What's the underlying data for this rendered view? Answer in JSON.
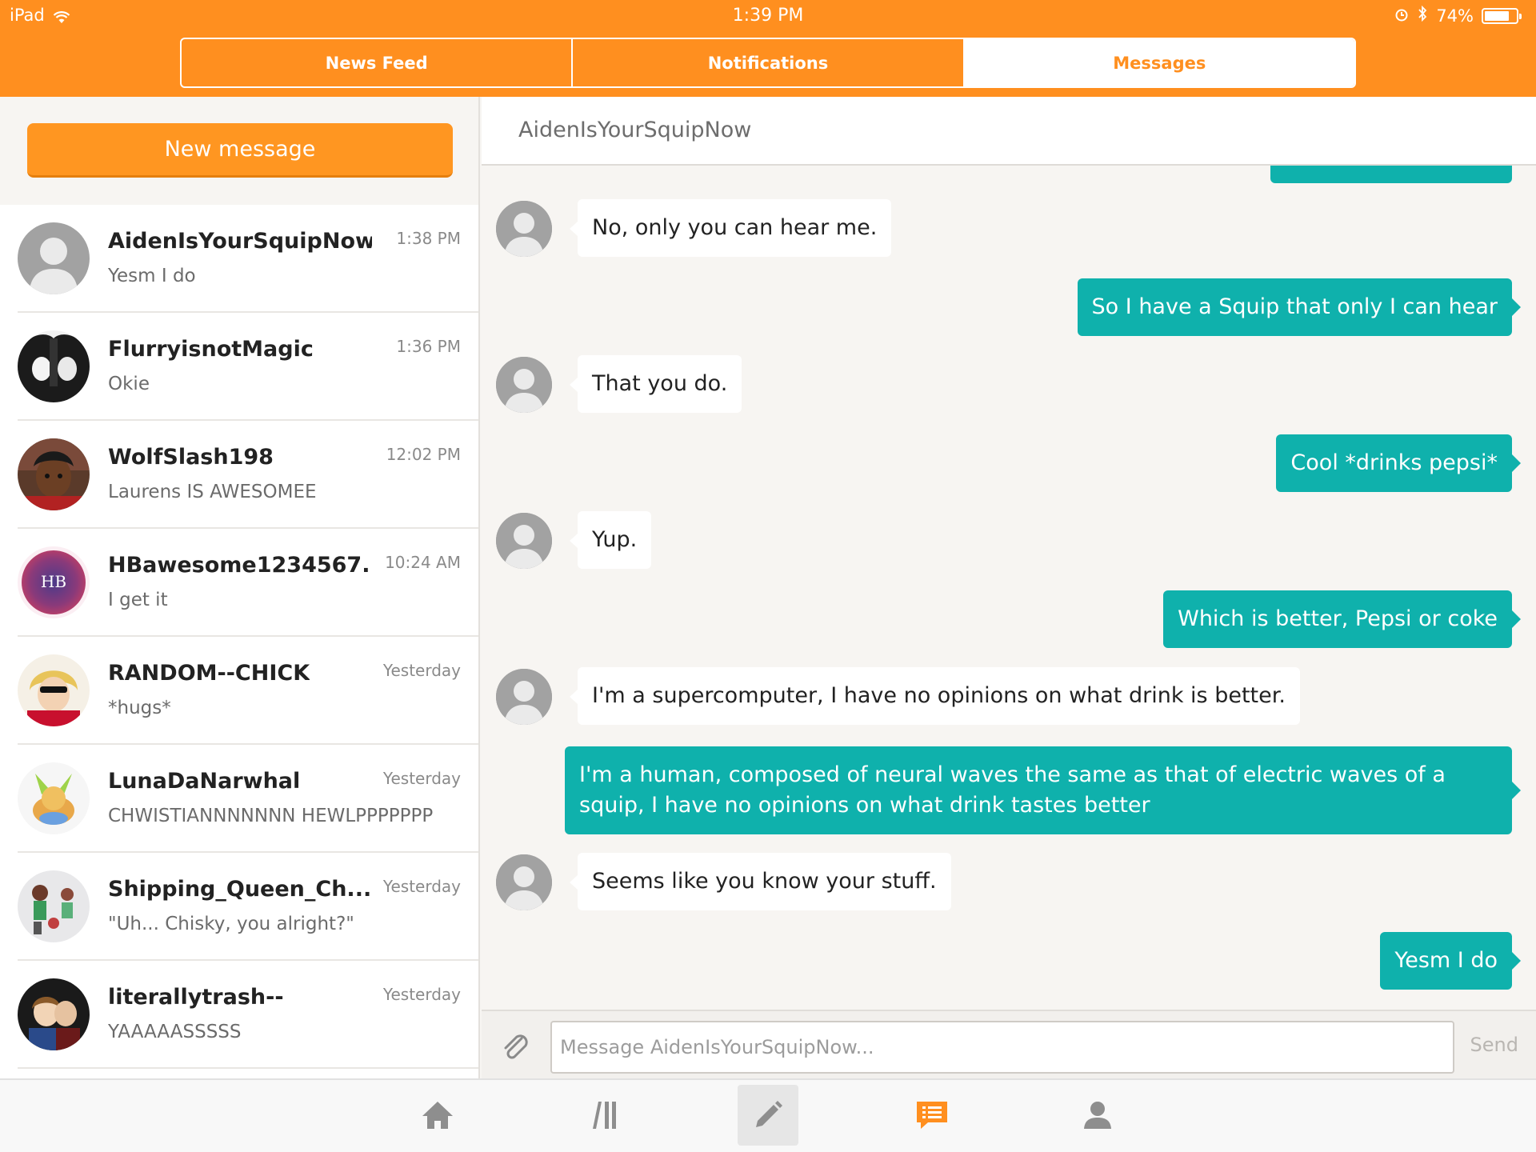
{
  "status_bar": {
    "device": "iPad",
    "time": "1:39 PM",
    "battery": "74%"
  },
  "segments": [
    {
      "label": "News Feed",
      "active": false
    },
    {
      "label": "Notifications",
      "active": false
    },
    {
      "label": "Messages",
      "active": true
    }
  ],
  "sidebar": {
    "new_message_label": "New message",
    "conversations": [
      {
        "name": "AidenIsYourSquipNow",
        "preview": "Yesm I do",
        "time": "1:38 PM",
        "avatar": "default-avatar"
      },
      {
        "name": "FlurryisnotMagic",
        "preview": "Okie",
        "time": "1:36 PM",
        "avatar": "anime-avatar"
      },
      {
        "name": "WolfSlash198",
        "preview": "Laurens IS AWESOMEE",
        "time": "12:02 PM",
        "avatar": "character-avatar"
      },
      {
        "name": "HBawesome1234567...",
        "preview": "I get it",
        "time": "10:24 AM",
        "avatar": "hb-watercolor-avatar",
        "avatar_text": "HB"
      },
      {
        "name": "RANDOM--CHICK",
        "preview": "*hugs*",
        "time": "Yesterday",
        "avatar": "blonde-character-avatar"
      },
      {
        "name": "LunaDaNarwhal",
        "preview": "CHWISTIANNNNNNN HEWLPPPPPPP",
        "time": "Yesterday",
        "avatar": "eevee-avatar"
      },
      {
        "name": "Shipping_Queen_Ch...",
        "preview": "\"Uh... Chisky, you alright?\"",
        "time": "Yesterday",
        "avatar": "sprites-avatar"
      },
      {
        "name": "literallytrash--",
        "preview": "YAAAAASSSSS",
        "time": "Yesterday",
        "avatar": "couple-avatar"
      }
    ]
  },
  "chat": {
    "title": "AidenIsYourSquipNow",
    "messages": [
      {
        "direction": "in",
        "text": "No, only you can hear me."
      },
      {
        "direction": "out",
        "text": "So I have a Squip that only I can hear"
      },
      {
        "direction": "in",
        "text": "That you do."
      },
      {
        "direction": "out",
        "text": "Cool *drinks pepsi*"
      },
      {
        "direction": "in",
        "text": "Yup."
      },
      {
        "direction": "out",
        "text": "Which is better, Pepsi or coke"
      },
      {
        "direction": "in",
        "text": "I'm a supercomputer, I have no opinions on what drink is better."
      },
      {
        "direction": "out",
        "text": "I'm a human, composed of neural waves the same as that of electric waves of a squip, I have no opinions on what drink tastes better"
      },
      {
        "direction": "in",
        "text": "Seems like you know your stuff."
      },
      {
        "direction": "out",
        "text": "Yesm I do"
      }
    ],
    "composer": {
      "placeholder": "Message AidenIsYourSquipNow...",
      "value": "",
      "send_label": "Send"
    }
  },
  "tabbar": {
    "items": [
      {
        "icon": "home-icon"
      },
      {
        "icon": "library-icon"
      },
      {
        "icon": "pencil-icon"
      },
      {
        "icon": "messages-icon"
      },
      {
        "icon": "profile-icon"
      }
    ],
    "active": "messages-icon"
  },
  "colors": {
    "brand_orange": "#ff8f1f",
    "outgoing_bubble": "#0fb1ac",
    "incoming_bubble": "#ffffff"
  }
}
